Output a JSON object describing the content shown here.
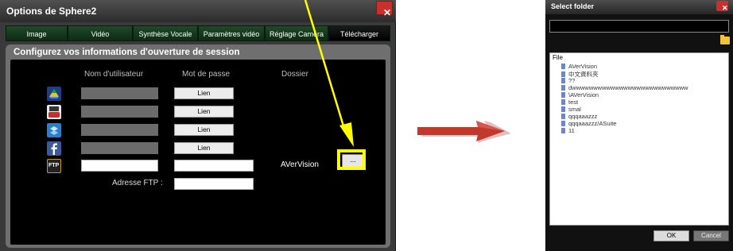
{
  "main_dialog": {
    "title": "Options de Sphere2",
    "tabs": [
      {
        "label": "Image"
      },
      {
        "label": "Vidéo"
      },
      {
        "label": "Synthèse Vocale"
      },
      {
        "label": "Paramètres vidéo"
      },
      {
        "label": "Réglage Caméra"
      },
      {
        "label": "Télécharger",
        "active": true
      }
    ],
    "heading": "Configurez vos informations d'ouverture de session",
    "columns": {
      "username": "Nom d'utilisateur",
      "password": "Mot de passe",
      "folder": "Dossier"
    },
    "services": [
      {
        "icon": "google-drive-icon",
        "button": "Lien"
      },
      {
        "icon": "youtube-icon",
        "button": "Lien"
      },
      {
        "icon": "dropbox-icon",
        "button": "Lien"
      },
      {
        "icon": "facebook-icon",
        "button": "Lien"
      },
      {
        "icon": "ftp-icon",
        "icon_text": "FTP",
        "folder_value": "AVerVision",
        "browse": "..."
      }
    ],
    "ftp_address_label": "Adresse FTP :"
  },
  "select_folder_dialog": {
    "title": "Select folder",
    "tree_header": "File",
    "items": [
      "AVerVision",
      "中文資料夾",
      "??",
      "dwwwwwwwwwwwwwwwwwwwwwwwwwww",
      "\\AVerVision",
      "test",
      "smal",
      "qqqaaazzz",
      "qqqaaazzz/ASuite",
      "11"
    ],
    "ok": "OK",
    "cancel": "Cancel"
  },
  "colors": {
    "highlight": "#ffff00",
    "arrow_red": "#c0392b",
    "tab_green": "#1f4a27"
  }
}
